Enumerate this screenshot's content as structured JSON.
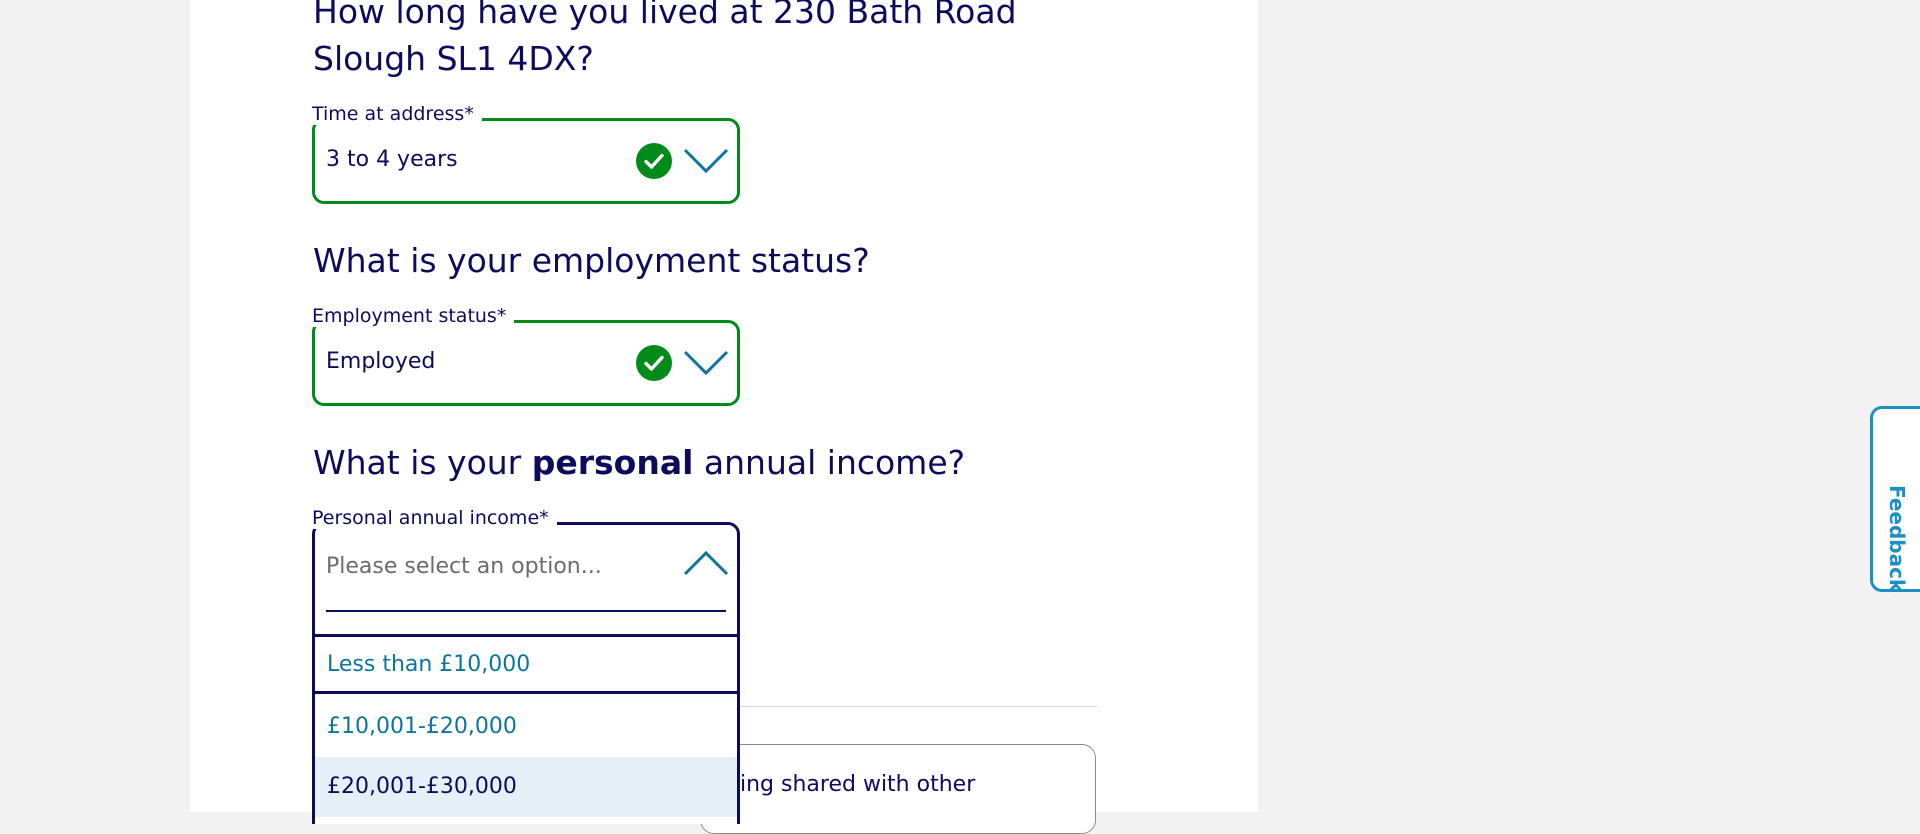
{
  "questions": {
    "time_at_address": "How long have you lived at 230 Bath Road Slough SL1 4DX?",
    "employment": "What is your employment status?",
    "income_prefix": "What is your",
    "income_emphasis": "personal",
    "income_suffix": "annual income?"
  },
  "fields": {
    "time_at_address": {
      "label": "Time at address*",
      "value": "3 to 4 years",
      "status": "valid"
    },
    "employment_status": {
      "label": "Employment status*",
      "value": "Employed",
      "status": "valid"
    },
    "personal_income": {
      "label": "Personal annual income*",
      "placeholder": "Please select an option...",
      "state": "open",
      "options": [
        "Less than £10,000",
        "£10,001-£20,000",
        "£20,001-£30,000"
      ],
      "highlighted_index": 2
    }
  },
  "partially_hidden": {
    "text": "ing shared with other"
  },
  "feedback": {
    "label": "Feedback"
  },
  "colors": {
    "navy": "#0d0b5c",
    "success": "#008a1a",
    "link": "#0d74a0",
    "highlight": "#e4eff7",
    "feedback": "#1c8fc4"
  },
  "icons": {
    "valid": "check-circle-icon",
    "closed": "chevron-down-icon",
    "open": "chevron-up-icon"
  }
}
